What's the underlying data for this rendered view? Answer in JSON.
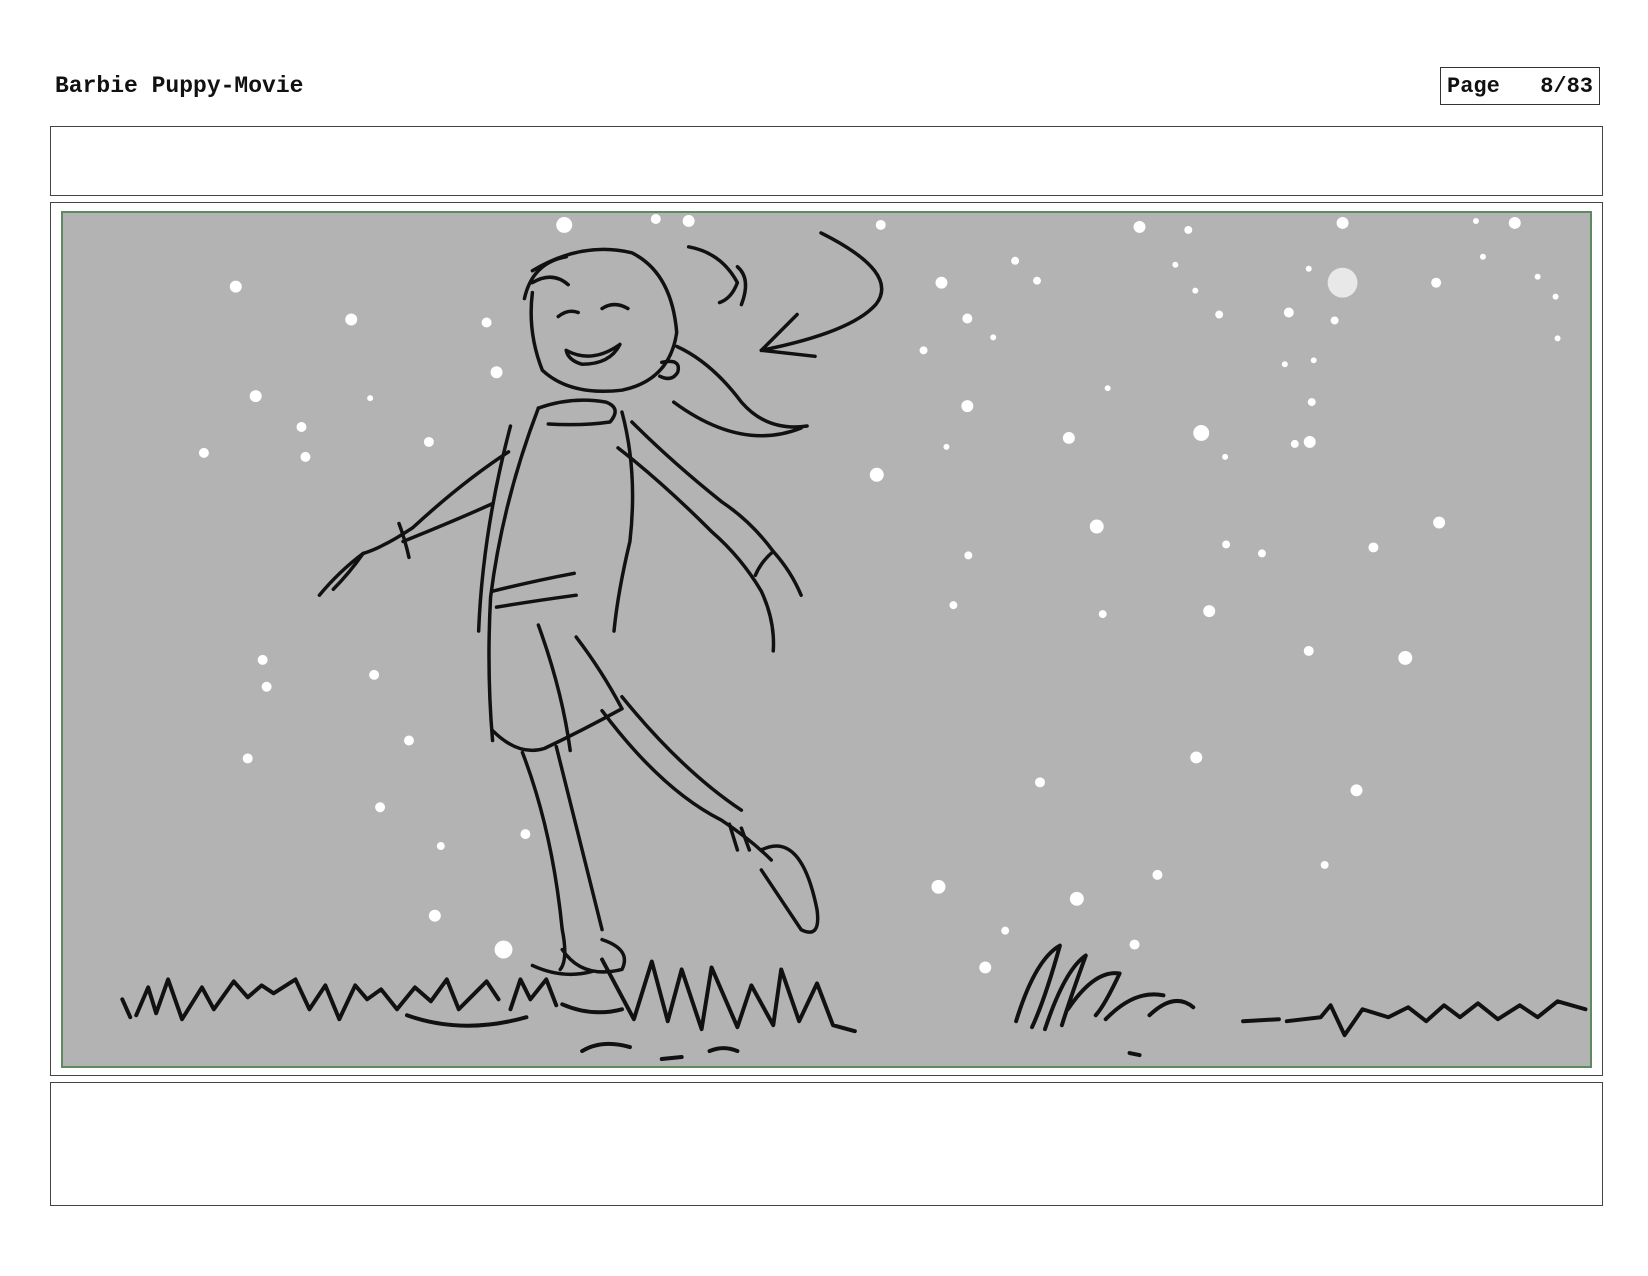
{
  "header": {
    "title": "Barbie Puppy-Movie",
    "page_label": "Page",
    "page_number": "8/83"
  },
  "panel": {
    "background_color": "#b3b3b3",
    "border_color": "#5f8a5f"
  }
}
